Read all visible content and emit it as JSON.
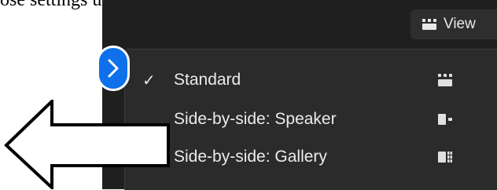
{
  "document": {
    "text": "ose settings under the"
  },
  "toolbar": {
    "view_label": "View",
    "view_icon": "grid-view-icon"
  },
  "view_menu": {
    "items": [
      {
        "label": "Standard",
        "checked": true,
        "icon": "standard-layout-icon"
      },
      {
        "label": "Side-by-side: Speaker",
        "checked": false,
        "icon": "side-by-side-speaker-icon"
      },
      {
        "label": "Side-by-side: Gallery",
        "checked": false,
        "icon": "side-by-side-gallery-icon"
      }
    ]
  },
  "colors": {
    "app_background": "#1f1f1f",
    "menu_background": "#2b2b2b",
    "accent_blue": "#0e71eb",
    "text": "#ececec"
  }
}
